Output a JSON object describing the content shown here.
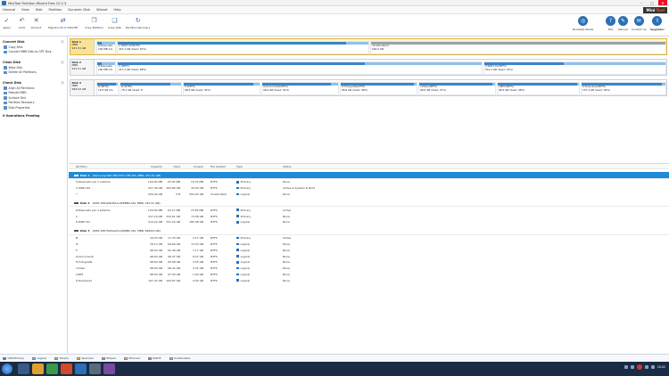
{
  "window": {
    "title": "MiniTool Partition Wizard Free 10.2.3",
    "controls": [
      "–",
      "▢",
      "✕"
    ]
  },
  "menu": [
    "General",
    "View",
    "Disk",
    "Partition",
    "Dynamic Disk",
    "Wizard",
    "Help"
  ],
  "brand": {
    "left": "Mini",
    "right": "Tool"
  },
  "toolbar": {
    "left": [
      {
        "label": "Apply",
        "icon": "✓"
      },
      {
        "label": "Undo",
        "icon": "↶"
      },
      {
        "label": "Discard",
        "icon": "✕"
      },
      {
        "label": "Migrate OS to SSD/HD",
        "icon": "⇄"
      },
      {
        "label": "Copy Partition",
        "icon": "❐"
      },
      {
        "label": "Copy Disk",
        "icon": "❏"
      },
      {
        "label": "Partition Recovery",
        "icon": "↻"
      }
    ],
    "right": [
      {
        "label": "Bootable Media",
        "icon": "◎"
      },
      {
        "label": "FAQ",
        "icon": "?"
      },
      {
        "label": "Manual",
        "icon": "✎"
      },
      {
        "label": "Contact Us",
        "icon": "✉"
      },
      {
        "label": "Upgrade!",
        "icon": "⇧"
      }
    ]
  },
  "sidebar": {
    "sections": [
      {
        "title": "Convert Disk",
        "items": [
          "Copy Disk",
          "Convert MBR Disk to GPT Disk"
        ]
      },
      {
        "title": "Clean Disk",
        "items": [
          "Wipe Disk",
          "Delete All Partitions"
        ]
      },
      {
        "title": "Check Disk",
        "items": [
          "Align All Partitions",
          "Rebuild MBR",
          "Surface Test",
          "Partition Recovery",
          "Disk Properties"
        ]
      }
    ],
    "pending": "0 Operations Pending"
  },
  "diskmap": [
    {
      "name": "Disk 1",
      "type": "MBR",
      "size": "931.51 GB",
      "selected": true,
      "parts": [
        {
          "label": "G:Riservato",
          "detail": "100 MB (Us",
          "used": 0.25
        },
        {
          "label": "C:WIN7-64(NTFS)",
          "detail": "427.4 GB (Used: 91%)",
          "used": 0.91
        },
        {
          "label": "(Unallocated)",
          "detail": "504.0 GB",
          "used": 0,
          "gray": true
        }
      ]
    },
    {
      "name": "Disk 2",
      "type": "MBR",
      "size": "931.51 GB",
      "selected": false,
      "parts": [
        {
          "label": "R:Riservato",
          "detail": "100 MB (Us",
          "used": 0.25
        },
        {
          "label": "L:(NTFS)",
          "detail": "417.2 GB (Used: 68%)",
          "used": 0.68
        },
        {
          "label": "P:WIN7-64(NTFS)",
          "detail": "514.2 GB (Used: 44%)",
          "used": 0.44
        }
      ]
    },
    {
      "name": "Disk 3",
      "type": "MBR",
      "size": "698.64 GB",
      "selected": false,
      "parts": [
        {
          "label": "B:(NTFS)",
          "detail": "19.5 GB (Us",
          "used": 0.9
        },
        {
          "label": "D:(NTFS)",
          "detail": "78.1 GB (Used: 8",
          "used": 0.82
        },
        {
          "label": "F:(NTFS)",
          "detail": "98.6 GB (Used: 92%)",
          "used": 0.92
        },
        {
          "label": "G:Documenti(NTFS)",
          "detail": "98.6 GB (Used: 91%)",
          "used": 0.91
        },
        {
          "label": "H:Fotografie(NTFS)",
          "detail": "98.6 GB (Used: 96%)",
          "used": 0.96
        },
        {
          "label": "I:Video(NTFS)",
          "detail": "98.6 GB (Used: 97%)",
          "used": 0.97
        },
        {
          "label": "J:MP3(NTFS)",
          "detail": "98.6 GB (Used: 98%)",
          "used": 0.98
        },
        {
          "label": "K:Download(NTFS)",
          "detail": "107.4 GB (Used: 96%)",
          "used": 0.96
        }
      ]
    }
  ],
  "table": {
    "headers": [
      "Partition",
      "Capacity",
      "Used",
      "Unused",
      "File System",
      "Type",
      "Status"
    ],
    "disks": [
      {
        "title": "Disk 1",
        "desc": "(Samsung SSD 850 EVO 1TB ATA, MBR, 931.51 GB)",
        "selected": true,
        "rows": [
          [
            "G:Riservato per il sistema",
            "100.00 MB",
            "25.30 MB",
            "74.70 MB",
            "NTFS",
            "Primary",
            "None"
          ],
          [
            "C:WIN7-64",
            "427.39 GB",
            "392.80 GB",
            "34.59 GB",
            "NTFS",
            "Primary",
            "Active & System & Boot"
          ],
          [
            "*:",
            "504.02 GB",
            "0 B",
            "504.02 GB",
            "Unallocated",
            "Logical",
            "None"
          ]
        ]
      },
      {
        "title": "Disk 2",
        "desc": "(WDC WD1001FALS-00E8B0 ATA, MBR, 931.51 GB)",
        "selected": false,
        "rows": [
          [
            "R:Riservato per il sistema",
            "100.00 MB",
            "24.17 MB",
            "75.83 MB",
            "NTFS",
            "Primary",
            "Active"
          ],
          [
            "L:",
            "417.19 GB",
            "343.61 GB",
            "73.58 GB",
            "NTFS",
            "Primary",
            "None"
          ],
          [
            "P:WIN7-64",
            "514.22 GB",
            "331.24 GB",
            "182.98 GB",
            "NTFS",
            "Logical",
            "None"
          ]
        ]
      },
      {
        "title": "Disk 3",
        "desc": "(WDC WD7500AACS-00ZJB0 ATA, MBR, 698.64 GB)",
        "selected": false,
        "rows": [
          [
            "B:",
            "19.53 GB",
            "17.76 GB",
            "2.17 GB",
            "NTFS",
            "Primary",
            "Active"
          ],
          [
            "D:",
            "78.13 GB",
            "64.60 GB",
            "13.53 GB",
            "NTFS",
            "Logical",
            "None"
          ],
          [
            "F:",
            "98.63 GB",
            "91.46 GB",
            "7.17 GB",
            "NTFS",
            "Logical",
            "None"
          ],
          [
            "G:Documenti",
            "98.63 GB",
            "90.37 GB",
            "8.27 GB",
            "NTFS",
            "Logical",
            "None"
          ],
          [
            "H:Fotografie",
            "98.63 GB",
            "95.08 GB",
            "3.55 GB",
            "NTFS",
            "Logical",
            "None"
          ],
          [
            "I:Video",
            "98.63 GB",
            "96.42 GB",
            "2.21 GB",
            "NTFS",
            "Logical",
            "None"
          ],
          [
            "J:MP3",
            "98.63 GB",
            "97.00 GB",
            "1.63 GB",
            "NTFS",
            "Logical",
            "None"
          ],
          [
            "K:Download",
            "107.43 GB",
            "102.87 GB",
            "4.55 GB",
            "NTFS",
            "Logical",
            "None"
          ]
        ]
      }
    ]
  },
  "legend": [
    {
      "label": "GPT/Primary",
      "color": "#2b6fb6"
    },
    {
      "label": "Logical",
      "color": "#6fb0e8"
    },
    {
      "label": "Simple",
      "color": "#9bd36a"
    },
    {
      "label": "Spanned",
      "color": "#e8c33a"
    },
    {
      "label": "Striped",
      "color": "#b98be0"
    },
    {
      "label": "Mirrored",
      "color": "#d9c88a"
    },
    {
      "label": "RAID5",
      "color": "#e06a6a"
    },
    {
      "label": "Unallocated",
      "color": "#bcbcbc"
    }
  ],
  "taskbar": {
    "time": "20:02"
  }
}
